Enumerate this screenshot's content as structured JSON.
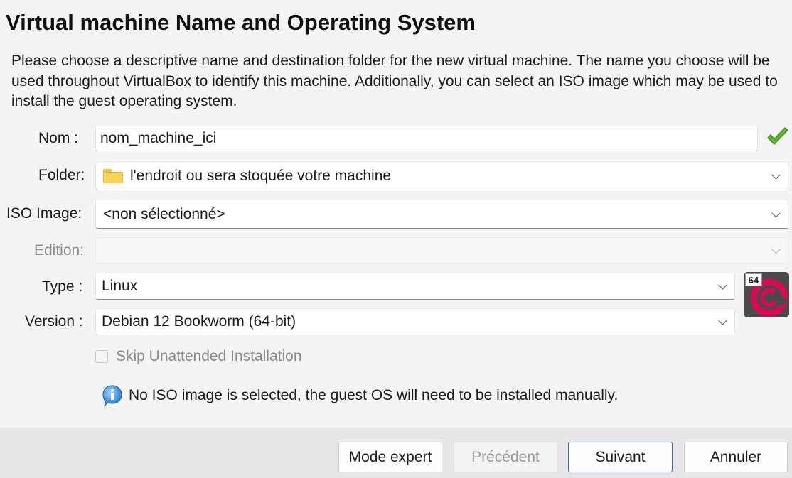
{
  "header": {
    "title": "Virtual machine Name and Operating System",
    "description": "Please choose a descriptive name and destination folder for the new virtual machine. The name you choose will be used throughout VirtualBox to identify this machine. Additionally, you can select an ISO image which may be used to install the guest operating system."
  },
  "form": {
    "name_label": "Nom :",
    "name_value": "nom_machine_ici",
    "name_valid_icon": "green-check-icon",
    "folder_label": "Folder:",
    "folder_icon": "folder-icon",
    "folder_value": "l'endroit ou sera stoquée votre machine",
    "iso_label": "ISO Image:",
    "iso_value": "<non sélectionné>",
    "edition_label": "Edition:",
    "edition_value": "",
    "type_label": "Type :",
    "type_value": "Linux",
    "version_label": "Version :",
    "version_value": "Debian 12 Bookworm (64-bit)",
    "os_icon": "debian-logo-icon",
    "os_badge": "64",
    "skip_label": "Skip Unattended Installation",
    "skip_checked": false,
    "info_icon": "info-icon",
    "info_text": "No ISO image is selected, the guest OS will need to be installed manually."
  },
  "buttons": {
    "expert": "Mode expert",
    "previous": "Précédent",
    "next": "Suivant",
    "cancel": "Annuler"
  },
  "colors": {
    "accent_border": "#2f6fb3",
    "check_green": "#5fb832",
    "debian_red": "#d70a53"
  }
}
